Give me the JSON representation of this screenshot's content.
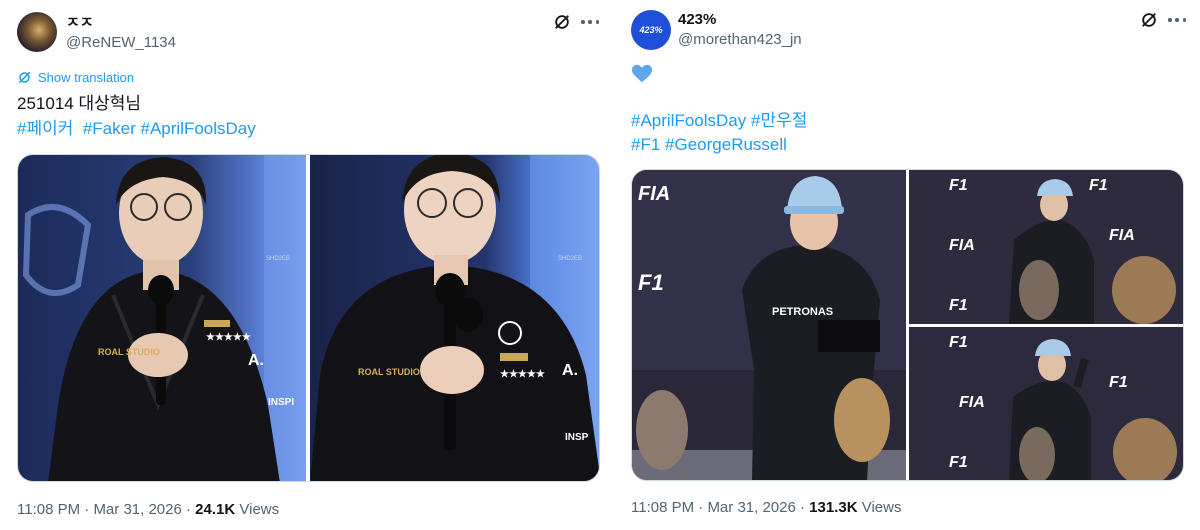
{
  "tweets": [
    {
      "display_name": "ㅈㅈ",
      "handle": "@ReNEW_1134",
      "translate_label": "Show translation",
      "text": "251014 대상혁님",
      "hashtags": [
        "#페이커",
        "#Faker",
        "#AprilFoolsDay"
      ],
      "time": "11:08 PM",
      "separator": "·",
      "date": "Mar 31, 2026",
      "views_count": "24.1K",
      "views_label": "Views",
      "media": [
        {
          "description": "photo-player-left",
          "watermark": "SHD2EB"
        },
        {
          "description": "photo-player-right",
          "watermark": "SHD2EB"
        }
      ]
    },
    {
      "display_name": "423%",
      "avatar_text": "423%",
      "handle": "@morethan423_jn",
      "emoji": "blue-heart",
      "hashtags_line1": [
        "#AprilFoolsDay",
        "#만우절"
      ],
      "hashtags_line2": [
        "#F1",
        "#GeorgeRussell"
      ],
      "time": "11:08 PM",
      "separator": "·",
      "date": "Mar 31, 2026",
      "views_count": "131.3K",
      "views_label": "Views",
      "media_logos": {
        "fia": "FIA",
        "petronas": "PETRONAS",
        "brand": "F1"
      }
    }
  ],
  "colors": {
    "accent": "#1d9bf0",
    "text_primary": "#0f1419",
    "text_secondary": "#536471",
    "heart": "#5ba7ea"
  },
  "icons": [
    "grok-icon",
    "more-icon",
    "translate-icon",
    "blue-heart-emoji"
  ]
}
